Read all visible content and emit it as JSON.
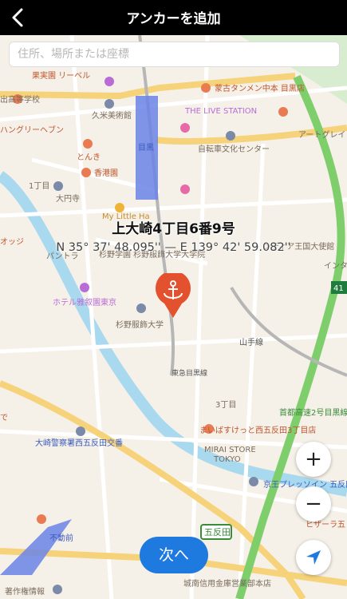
{
  "header": {
    "title": "アンカーを追加"
  },
  "search": {
    "placeholder": "住所、場所または座標"
  },
  "marker": {
    "address": "上大崎4丁目6番9号",
    "coordinates": "N 35° 37' 48.095'' — E 139° 42' 59.082''"
  },
  "map_labels": {
    "kajitsuen": "果実園 リーベル",
    "koutougakkou": "出高等学校",
    "shokudo": "蒙古タンメン中本 目黒店",
    "live": "THE LIVE STATION",
    "kume": "久米美術館",
    "hungry": "ハングリーヘブン",
    "artgre": "アートグレイ",
    "meguro": "目黒",
    "tonki": "とんき",
    "jitensha": "自転車文化センター",
    "kakou": "香港園",
    "itchome": "1丁目",
    "oenji": "大円寺",
    "mylittle": "My Little Ha",
    "oyaji": "オッジ",
    "pantora": "パントラ",
    "sugino_gakuen": "杉野学園 杉野服飾大学大学院",
    "india": "ンディア王国大使館",
    "inter": "インタ",
    "hotel": "ホテル雅叙園東京",
    "sugino_univ": "杉野服飾大学",
    "yamate": "山手線",
    "tokyu": "東急目黒線",
    "shuto": "首都高速2号目黒線",
    "sanchome": "3丁目",
    "mainbas": "まいばすけっと西五反田3丁目店",
    "mirai1": "MIRAI STORE",
    "mirai2": "TOKYO",
    "keio": "京王プレッソイン 五反田",
    "hizaria": "ヒザーラ五",
    "osaki_police": "大崎警察署西五反田交番",
    "fudomae": "不動前",
    "gotanda": "五反田",
    "route41": "41",
    "shinkin": "城南信用金庫営業部本店",
    "kenri": "著作権情報",
    "de": "で"
  },
  "controls": {
    "zoom_in": "+",
    "zoom_out": "−",
    "next_button": "次へ"
  }
}
